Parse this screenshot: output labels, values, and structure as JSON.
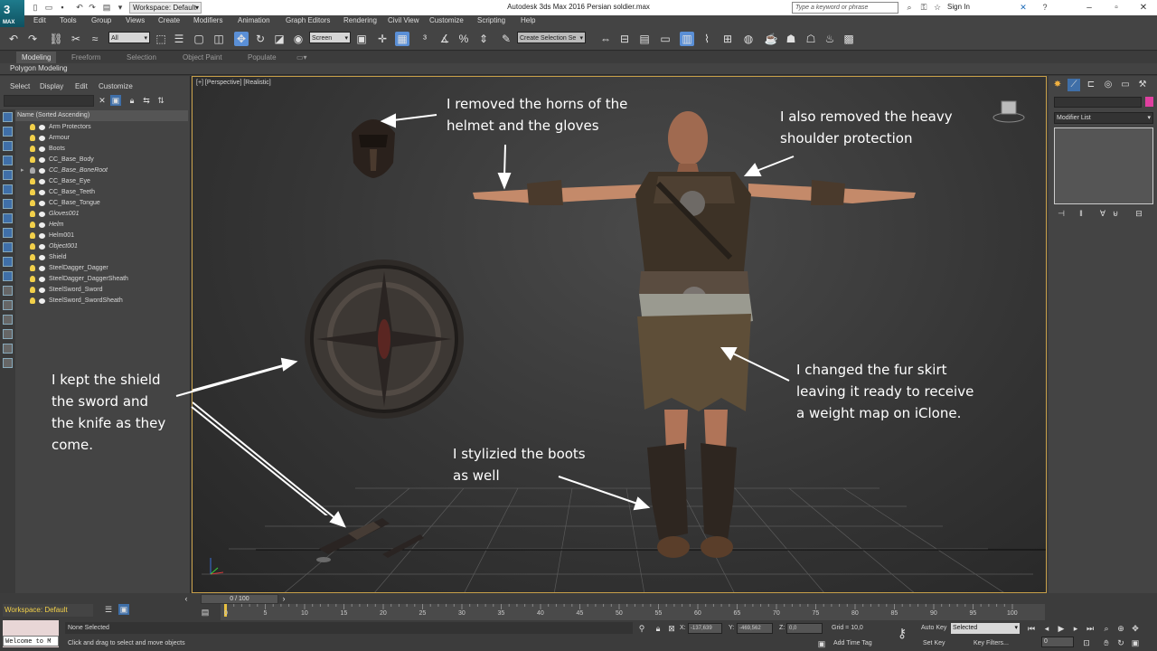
{
  "title_bar": {
    "logo": "MAX",
    "workspace": "Workspace: Default",
    "window_title": "Autodesk 3ds Max 2016     Persian soldier.max",
    "search_placeholder": "Type a keyword or phrase",
    "sign_in": "Sign In"
  },
  "menu": [
    "Edit",
    "Tools",
    "Group",
    "Views",
    "Create",
    "Modifiers",
    "Animation",
    "Graph Editors",
    "Rendering",
    "Civil View",
    "Customize",
    "Scripting",
    "Help"
  ],
  "toolbar": {
    "filter_value": "All",
    "refcoord_value": "Screen",
    "named_sel_placeholder": "Create Selection Se"
  },
  "ribbon": {
    "tabs": [
      "Modeling",
      "Freeform",
      "Selection",
      "Object Paint",
      "Populate"
    ],
    "active_tab": "Modeling",
    "panel": "Polygon Modeling"
  },
  "explorer": {
    "menu": [
      "Select",
      "Display",
      "Edit",
      "Customize"
    ],
    "column_header": "Name (Sorted Ascending)",
    "items": [
      {
        "name": "Arm Protectors",
        "italic": false,
        "light": true
      },
      {
        "name": "Armour",
        "italic": false,
        "light": true
      },
      {
        "name": "Boots",
        "italic": false,
        "light": true
      },
      {
        "name": "CC_Base_Body",
        "italic": false,
        "light": true
      },
      {
        "name": "CC_Base_BoneRoot",
        "italic": true,
        "light": false
      },
      {
        "name": "CC_Base_Eye",
        "italic": false,
        "light": true
      },
      {
        "name": "CC_Base_Teeth",
        "italic": false,
        "light": true
      },
      {
        "name": "CC_Base_Tongue",
        "italic": false,
        "light": true
      },
      {
        "name": "Gloves001",
        "italic": true,
        "light": true
      },
      {
        "name": "Helm",
        "italic": true,
        "light": true
      },
      {
        "name": "Helm001",
        "italic": false,
        "light": true
      },
      {
        "name": "Object001",
        "italic": true,
        "light": true
      },
      {
        "name": "Shield",
        "italic": false,
        "light": true
      },
      {
        "name": "SteelDagger_Dagger",
        "italic": false,
        "light": true
      },
      {
        "name": "SteelDagger_DaggerSheath",
        "italic": false,
        "light": true
      },
      {
        "name": "SteelSword_Sword",
        "italic": false,
        "light": true
      },
      {
        "name": "SteelSword_SwordSheath",
        "italic": false,
        "light": true
      }
    ]
  },
  "viewport": {
    "label": "[+] [Perspective] [Realistic]",
    "annotations": {
      "horns_1": "I removed the horns of the",
      "horns_2": "helmet and the gloves",
      "shoulder_1": "I also removed the heavy",
      "shoulder_2": "shoulder protection",
      "shield_1": "I kept the shield",
      "shield_2": "the sword and",
      "shield_3": "the knife as they",
      "shield_4": "come.",
      "fur_1": "I changed the fur skirt",
      "fur_2": "leaving it ready to receive",
      "fur_3": "a weight map on iClone.",
      "boots_1": "I stylizied the boots",
      "boots_2": "as well"
    }
  },
  "command_panel": {
    "modifier_list": "Modifier List",
    "swatch_color": "#e040a0"
  },
  "bottom": {
    "workspace": "Workspace: Default",
    "time_slider": "0 / 100",
    "ticks": [
      "0",
      "5",
      "10",
      "15",
      "20",
      "25",
      "30",
      "35",
      "40",
      "45",
      "50",
      "55",
      "60",
      "65",
      "70",
      "75",
      "80",
      "85",
      "90",
      "95",
      "100"
    ],
    "listener": "Welcome to M",
    "selection_status": "None Selected",
    "prompt": "Click and drag to select and move objects",
    "x_label": "X:",
    "x_value": "-137,639",
    "y_label": "Y:",
    "y_value": "-469,562",
    "z_label": "Z:",
    "z_value": "0,0",
    "grid": "Grid = 10,0",
    "add_time_tag": "Add Time Tag",
    "auto_key": "Auto Key",
    "set_key": "Set Key",
    "selected": "Selected",
    "key_filters": "Key Filters...",
    "frame": "0"
  }
}
